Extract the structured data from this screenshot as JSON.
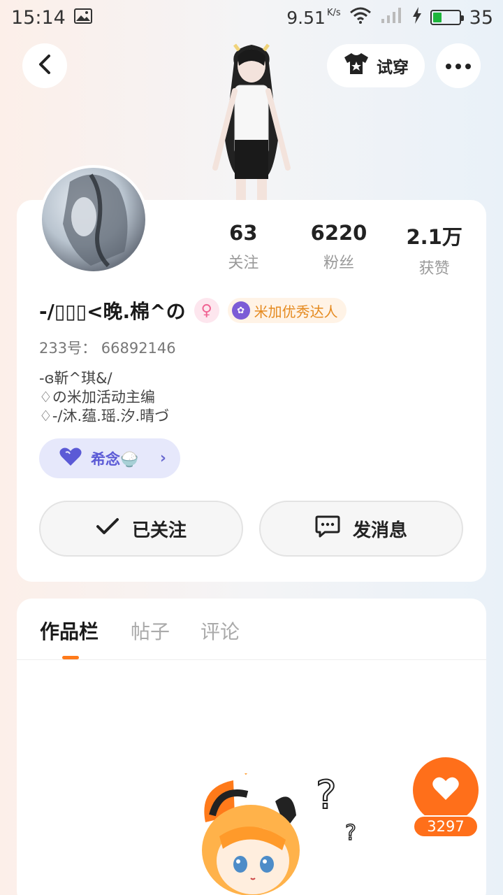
{
  "status_bar": {
    "time": "15:14",
    "speed": "9.51",
    "speed_unit": "K/s",
    "battery": "35",
    "battery_level": 0.35
  },
  "header": {
    "try_on_label": "试穿"
  },
  "profile": {
    "stats": [
      {
        "value": "63",
        "label": "关注"
      },
      {
        "value": "6220",
        "label": "粉丝"
      },
      {
        "value": "2.1万",
        "label": "获赞"
      }
    ],
    "name": "-/▯▯▯<晚.棉^の",
    "badge_label": "米加优秀达人",
    "id_line": "233号：  66892146",
    "bio_lines": [
      "-ɞ靳^琪&/",
      "♢の米加活动主编",
      "♢-/沐.蕴.瑶.汐.晴づ"
    ],
    "fan_club_label": "希念🍚",
    "follow_label": "已关注",
    "message_label": "发消息"
  },
  "tabs": [
    {
      "label": "作品栏",
      "active": true
    },
    {
      "label": "帖子",
      "active": false
    },
    {
      "label": "评论",
      "active": false
    }
  ],
  "like": {
    "count": "3297"
  },
  "colors": {
    "accent": "#ff6f1a",
    "fan_pill_bg": "#e6e8fb",
    "fan_pill_text": "#5b5ad6",
    "badge_text": "#e58a1f"
  }
}
